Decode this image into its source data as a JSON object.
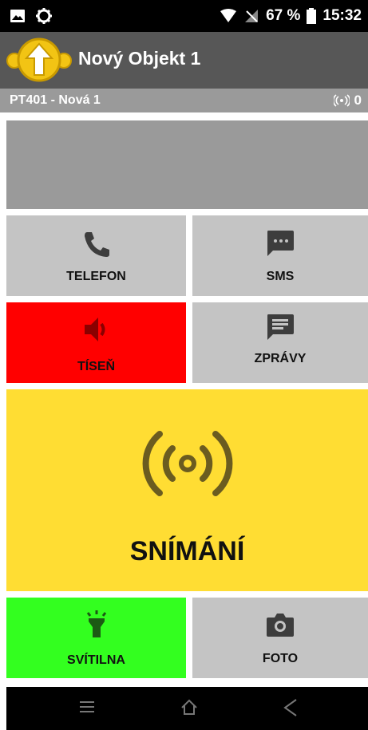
{
  "status_bar": {
    "battery_percent": "67 %",
    "time": "15:32",
    "icons": [
      "image-icon",
      "settings-icon",
      "wifi-icon",
      "signal-icon",
      "battery-icon"
    ]
  },
  "app_bar": {
    "title": "Nový Objekt 1"
  },
  "sub_bar": {
    "device": "PT401 - Nová 1",
    "signal_count": "0"
  },
  "tiles": {
    "telefon": "TELEFON",
    "sms": "SMS",
    "tisen": "TÍSEŇ",
    "zpravy": "ZPRÁVY",
    "sniman": "SNÍMÁNÍ",
    "svitilna": "SVÍTILNA",
    "foto": "FOTO"
  },
  "colors": {
    "alarm": "#ff0000",
    "scan": "#ffdd33",
    "torch": "#33ff1f",
    "tile": "#c4c4c4"
  }
}
